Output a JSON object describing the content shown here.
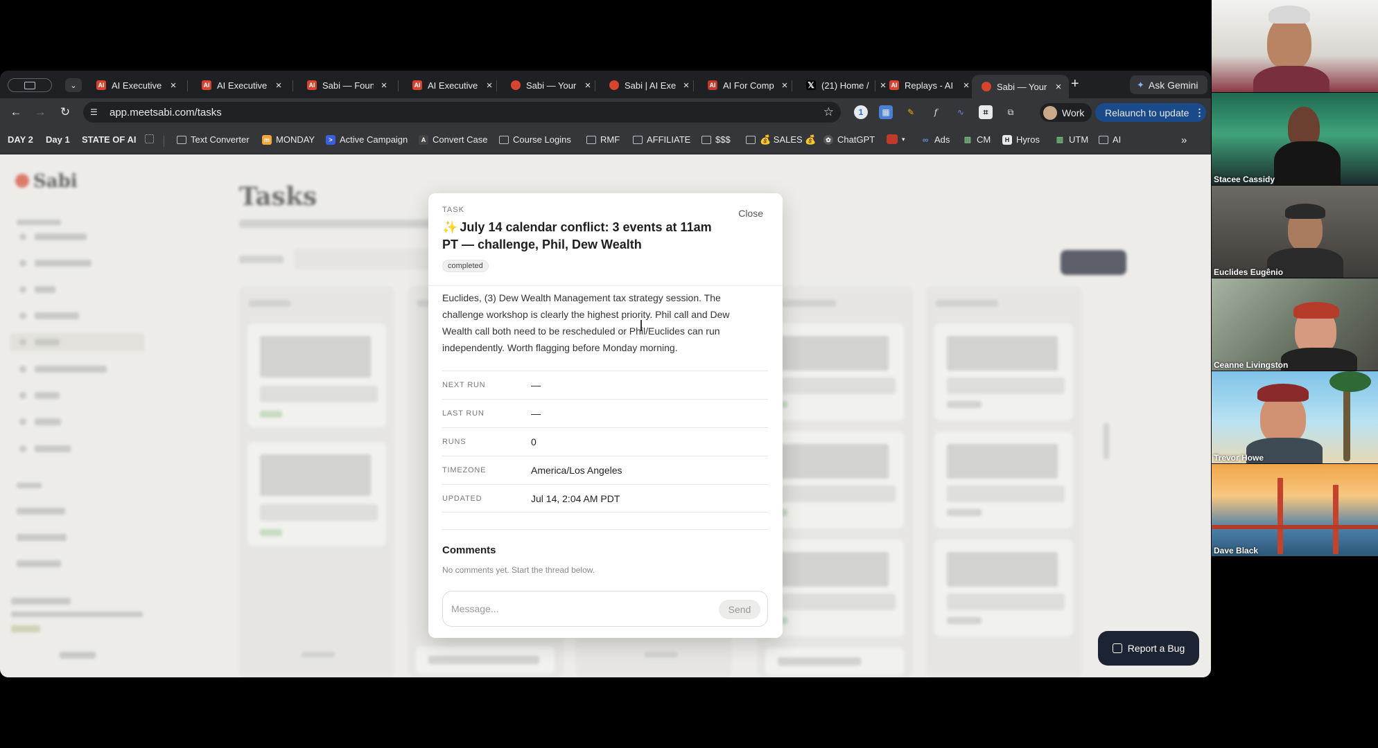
{
  "browser": {
    "tabs": [
      {
        "title": "AI Executive",
        "favicon_color": "#d9442e"
      },
      {
        "title": "AI Executive",
        "favicon_color": "#d9442e"
      },
      {
        "title": "Sabi — Foun",
        "favicon_color": "#d9442e"
      },
      {
        "title": "AI Executive",
        "favicon_color": "#d9442e"
      },
      {
        "title": "Sabi — Your",
        "favicon_color": "#d9442e"
      },
      {
        "title": "Sabi | AI Exe",
        "favicon_color": "#d9442e"
      },
      {
        "title": "AI For Comp",
        "favicon_color": "#c0392b"
      },
      {
        "title": "(21) Home /",
        "favicon_color": "#000000"
      },
      {
        "title": "Replays - AI",
        "favicon_color": "#d9442e"
      },
      {
        "title": "Sabi — Your",
        "favicon_color": "#d9442e",
        "active": true
      }
    ],
    "ask_gemini": "Ask Gemini",
    "url": "app.meetsabi.com/tasks",
    "profile_label": "Work",
    "relaunch_label": "Relaunch to update",
    "bookmarks": [
      {
        "label": "DAY 2"
      },
      {
        "label": "Day 1"
      },
      {
        "label": "STATE OF AI"
      },
      {
        "label": "Text Converter"
      },
      {
        "label": "MONDAY"
      },
      {
        "label": "Active Campaign"
      },
      {
        "label": "Convert Case"
      },
      {
        "label": "Course Logins"
      },
      {
        "label": "RMF"
      },
      {
        "label": "AFFILIATE"
      },
      {
        "label": "$$$"
      },
      {
        "label": "💰 SALES 💰"
      },
      {
        "label": "ChatGPT"
      },
      {
        "label": "Ads"
      },
      {
        "label": "CM"
      },
      {
        "label": "Hyros"
      },
      {
        "label": "UTM"
      },
      {
        "label": "AI"
      }
    ]
  },
  "app": {
    "logo": "Sabi",
    "page_title": "Tasks"
  },
  "modal": {
    "label": "TASK",
    "close_label": "Close",
    "title_icon": "✨",
    "title": "July 14 calendar conflict: 3 events at 11am PT — challenge, Phil, Dew Wealth",
    "status": "completed",
    "description": "Euclides, (3) Dew Wealth Management tax strategy session. The challenge workshop is clearly the highest priority. Phil call and Dew Wealth call both need to be rescheduled or Phil/Euclides can run independently. Worth flagging before Monday morning.",
    "fields": [
      {
        "key": "NEXT RUN",
        "value": "—"
      },
      {
        "key": "LAST RUN",
        "value": "—"
      },
      {
        "key": "RUNS",
        "value": "0"
      },
      {
        "key": "TIMEZONE",
        "value": "America/Los Angeles"
      },
      {
        "key": "UPDATED",
        "value": "Jul 14, 2:04 AM PDT"
      }
    ],
    "comments_heading": "Comments",
    "comments_empty": "No comments yet. Start the thread below.",
    "message_placeholder": "Message...",
    "send_label": "Send"
  },
  "report_bug": "Report a Bug",
  "participants": [
    {
      "name": "",
      "bg": "#6b4a3e"
    },
    {
      "name": "Stacee Cassidy",
      "bg": "#2b5d3a"
    },
    {
      "name": "Euclides Eugênio",
      "bg": "#4a4440"
    },
    {
      "name": "Ceanne Livingston",
      "bg": "#6e5e52"
    },
    {
      "name": "Trevor Howe",
      "bg": "#5a8fb0"
    },
    {
      "name": "Dave Black",
      "bg": "#3b6d9a"
    }
  ]
}
